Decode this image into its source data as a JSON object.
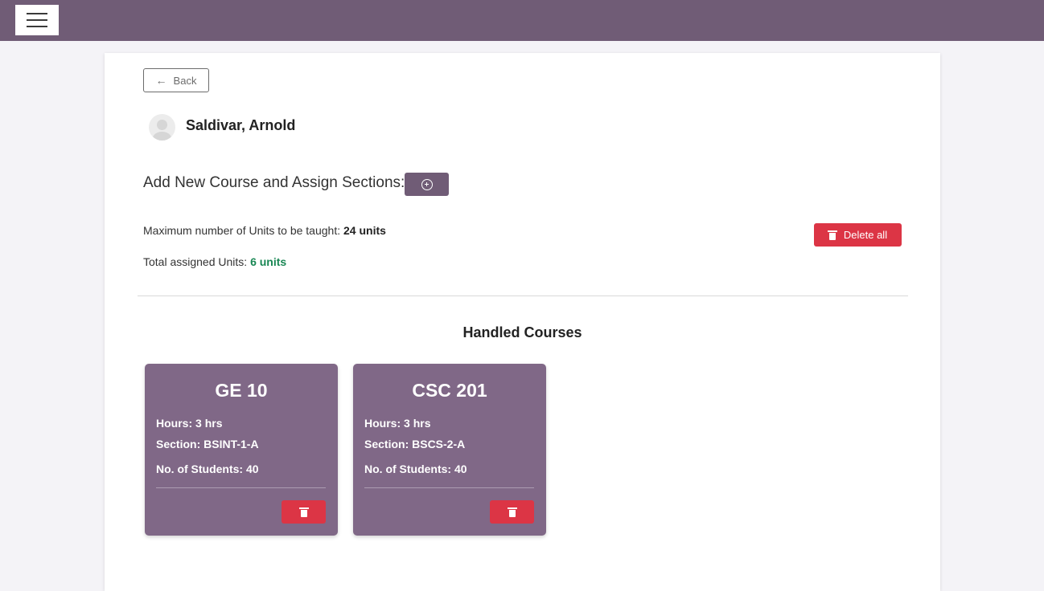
{
  "header": {
    "menu_icon": "hamburger-icon"
  },
  "back": {
    "label": "Back",
    "icon": "arrow-left-icon"
  },
  "profile": {
    "name": "Saldivar, Arnold",
    "avatar_icon": "user-avatar-icon"
  },
  "add_course": {
    "label": "Add New Course and Assign Sections:",
    "icon": "plus-circle-icon"
  },
  "units": {
    "max_label": "Maximum number of Units to be taught:",
    "max_value": "24 units",
    "total_label": "Total assigned Units:",
    "total_value": "6 units",
    "total_color": "#198754"
  },
  "delete_all": {
    "label": "Delete all",
    "icon": "trash-icon",
    "color": "#dc3545"
  },
  "handled": {
    "title": "Handled Courses",
    "courses": [
      {
        "code": "GE 10",
        "hours_label": "Hours:",
        "hours": "3 hrs",
        "section_label": "Section:",
        "section": "BSINT-1-A",
        "students_label": "No. of Students:",
        "students": "40"
      },
      {
        "code": "CSC 201",
        "hours_label": "Hours:",
        "hours": "3 hrs",
        "section_label": "Section:",
        "section": "BSCS-2-A",
        "students_label": "No. of Students:",
        "students": "40"
      }
    ]
  },
  "colors": {
    "brand": "#705c76",
    "card": "#806887",
    "danger": "#dc3545"
  }
}
